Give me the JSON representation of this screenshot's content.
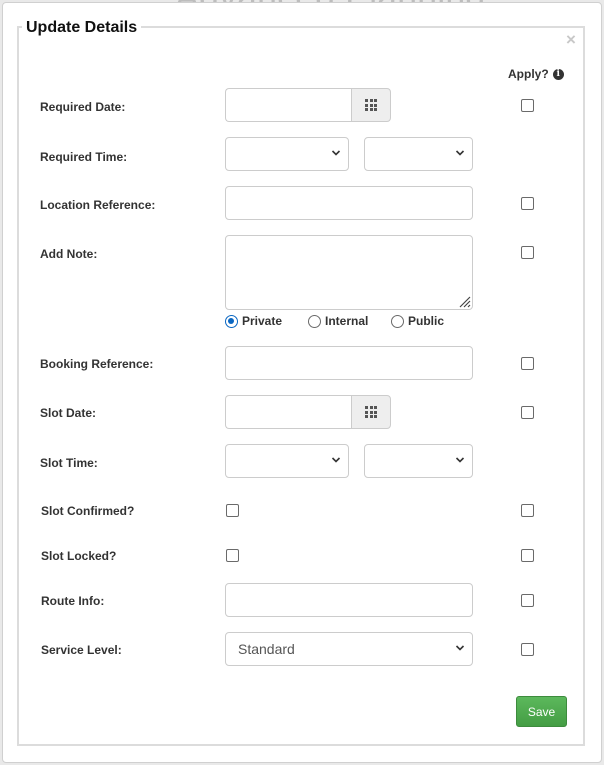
{
  "background": {
    "title": "Advanced Planning"
  },
  "modal": {
    "title": "Update Details",
    "close_glyph": "×",
    "apply_header": "Apply?",
    "info_glyph": "i",
    "labels": {
      "required_date": "Required Date:",
      "required_time": "Required Time:",
      "location_reference": "Location Reference:",
      "add_note": "Add Note:",
      "booking_reference": "Booking Reference:",
      "slot_date": "Slot Date:",
      "slot_time": "Slot Time:",
      "slot_confirmed": "Slot Confirmed?",
      "slot_locked": "Slot Locked?",
      "route_info": "Route Info:",
      "service_level": "Service Level:"
    },
    "fields": {
      "required_date": "",
      "required_time_hour": "",
      "required_time_minute": "",
      "location_reference": "",
      "note": "",
      "booking_reference": "",
      "slot_date": "",
      "slot_time_hour": "",
      "slot_time_minute": "",
      "route_info": "",
      "service_level": "Standard"
    },
    "note_visibility": {
      "options": [
        "Private",
        "Internal",
        "Public"
      ],
      "selected": "Private"
    },
    "save_label": "Save"
  }
}
